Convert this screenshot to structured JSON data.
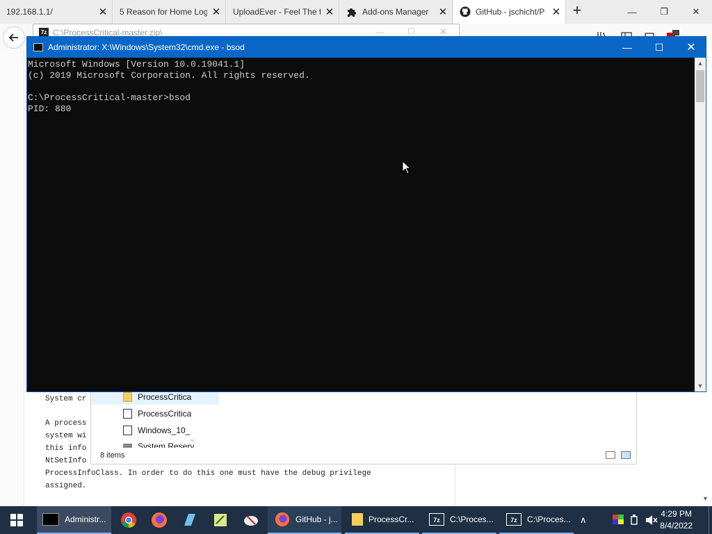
{
  "browser": {
    "tabs": [
      {
        "label": "192.168.1.1/"
      },
      {
        "label": "5 Reason for Home Log"
      },
      {
        "label": "UploadEver - Feel The f"
      },
      {
        "label": "Add-ons Manager"
      },
      {
        "label": "GitHub - jschicht/P"
      }
    ],
    "new_tab_label": "+",
    "close_glyph": "✕"
  },
  "sevenzip_window": {
    "title": "C:\\ProcessCritical-master.zip\\"
  },
  "cmd": {
    "title": "Administrator: X:\\Windows\\System32\\cmd.exe - bsod",
    "lines": [
      "Microsoft Windows [Version 10.0.19041.1]",
      "(c) 2019 Microsoft Corporation. All rights reserved.",
      "",
      "C:\\ProcessCritical-master>bsod",
      "PID: 880"
    ]
  },
  "page_text": {
    "line_top": "System cr",
    "lines": [
      "A process",
      "system wi",
      "this info",
      "NtSetInfo",
      "ProcessInfoClass. In order to do this one must have the debug privilege",
      "assigned."
    ]
  },
  "explorer": {
    "items": [
      {
        "label": "ProcessCritica",
        "icon": "folder-icon"
      },
      {
        "label": "ProcessCritica",
        "icon": "7zip-archive-icon"
      },
      {
        "label": "Windows_10_",
        "icon": "7zip-archive-icon"
      },
      {
        "label": "System Reserv",
        "icon": "drive-icon"
      }
    ],
    "status": "8 items"
  },
  "taskbar": {
    "items": [
      {
        "label": "Administr..."
      },
      {
        "label": "GitHub - j..."
      },
      {
        "label": "ProcessCr..."
      },
      {
        "label": "C:\\Proces..."
      },
      {
        "label": "C:\\Proces..."
      }
    ],
    "time": "4:29 PM",
    "date": "8/4/2022"
  },
  "colors": {
    "cmd_titlebar": "#0a67c8",
    "taskbar": "#1f2f44",
    "console_text": "#cccccc"
  }
}
